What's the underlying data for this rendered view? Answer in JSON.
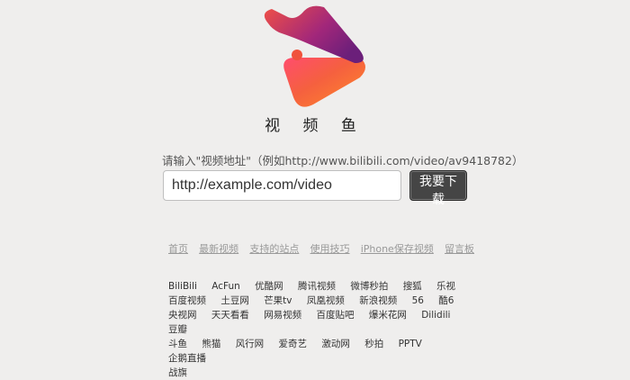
{
  "header": {
    "site_title": "视 频 鱼"
  },
  "search": {
    "hint": "请输入\"视频地址\"（例如http://www.bilibili.com/video/av9418782）",
    "placeholder": "http://example.com/video",
    "button_label": "我要下载"
  },
  "nav": {
    "links": [
      "首页",
      "最新视频",
      "支持的站点",
      "使用技巧",
      "iPhone保存视频",
      "留言板"
    ]
  },
  "sites": {
    "links": [
      "BiliBili",
      "AcFun",
      "优酷网",
      "腾讯视频",
      "微博秒拍",
      "搜狐",
      "乐视",
      "百度视频",
      "土豆网",
      "芒果tv",
      "凤凰视频",
      "新浪视频",
      "56",
      "酷6",
      "央视网",
      "天天看看",
      "网易视频",
      "百度贴吧",
      "爆米花网",
      "Dilidili",
      "豆瓣",
      "斗鱼",
      "熊猫",
      "风行网",
      "爱奇艺",
      "激动网",
      "秒拍",
      "PPTV",
      "企鹅直播",
      "战旗"
    ]
  },
  "colors": {
    "logo_start": "#ff3e56",
    "logo_mid": "#f76a3c",
    "logo_end": "#7a2070",
    "button_bg": "#454545"
  }
}
